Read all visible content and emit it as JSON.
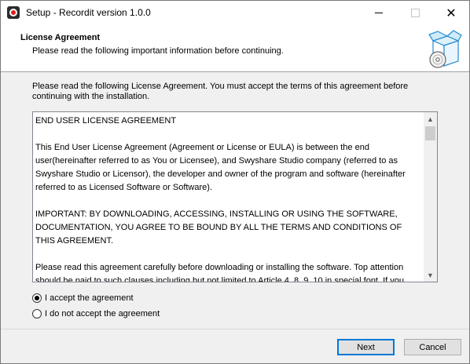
{
  "window": {
    "title": "Setup - Recordit version 1.0.0"
  },
  "titlebar": {
    "min_icon": "minimize-icon",
    "max_icon": "maximize-icon",
    "close_icon": "close-icon",
    "close_glyph": "✕"
  },
  "header": {
    "title": "License Agreement",
    "subtitle": "Please read the following important information before continuing.",
    "icon": "install-box-icon"
  },
  "intro": "Please read the following License Agreement. You must accept the terms of this agreement before continuing with the installation.",
  "license": {
    "text": "END USER LICENSE AGREEMENT\n\nThis End User License Agreement (Agreement or License or EULA) is between the end user(hereinafter referred to as You or Licensee), and Swyshare Studio company (referred to as Swyshare Studio or Licensor), the developer and owner of the program and software (hereinafter referred to as Licensed Software or Software).\n\nIMPORTANT: BY DOWNLOADING, ACCESSING, INSTALLING OR USING THE SOFTWARE, DOCUMENTATION, YOU AGREE TO BE BOUND BY ALL THE TERMS AND CONDITIONS OF THIS AGREEMENT.\n\nPlease read this agreement carefully before downloading or installing the software. Top attention should be paid to such clauses including but not limited to Article 4, 8, 9, 10 in special font. If you",
    "scroll_up": "▲",
    "scroll_down": "▼"
  },
  "options": {
    "accept": {
      "label": "I accept the agreement",
      "checked": true
    },
    "decline": {
      "label": "I do not accept the agreement",
      "checked": false
    }
  },
  "buttons": {
    "next": "Next",
    "cancel": "Cancel"
  },
  "colors": {
    "accent": "#0078d7",
    "app_icon_red": "#e02020"
  }
}
